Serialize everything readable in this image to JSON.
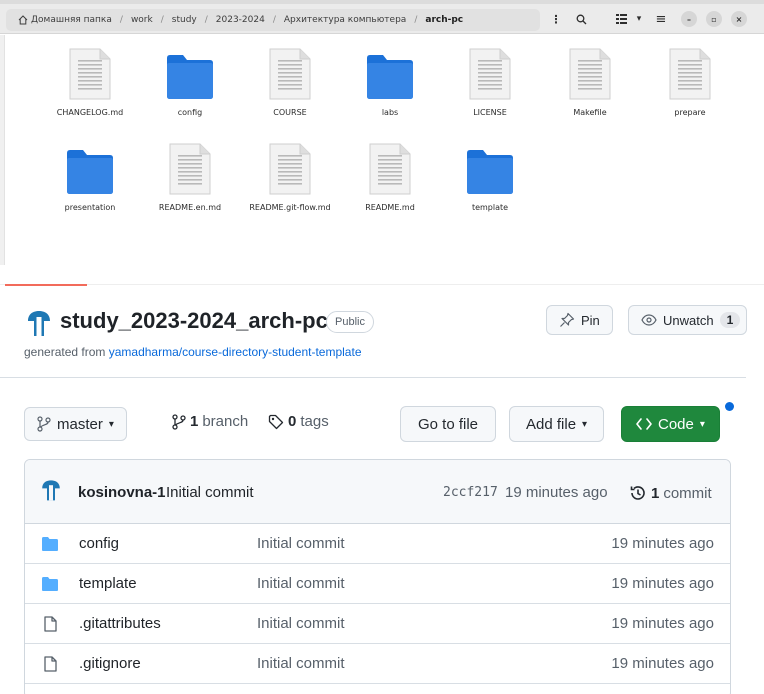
{
  "file_manager": {
    "breadcrumb": [
      "Домашняя папка",
      "work",
      "study",
      "2023-2024",
      "Архитектура компьютера",
      "arch-pc"
    ],
    "toolbar": {
      "menu_glyph": "⋮",
      "search_glyph": "🔍",
      "view_glyph": "⊞",
      "dropdown_glyph": "▾",
      "hamburger_glyph": "≡",
      "minimize_glyph": "–",
      "maximize_glyph": "▫",
      "close_glyph": "×"
    },
    "items": [
      {
        "name": "CHANGELOG.md",
        "kind": "document"
      },
      {
        "name": "config",
        "kind": "folder"
      },
      {
        "name": "COURSE",
        "kind": "document"
      },
      {
        "name": "labs",
        "kind": "folder"
      },
      {
        "name": "LICENSE",
        "kind": "document"
      },
      {
        "name": "Makefile",
        "kind": "document"
      },
      {
        "name": "prepare",
        "kind": "document"
      },
      {
        "name": "presentation",
        "kind": "folder"
      },
      {
        "name": "README.en.md",
        "kind": "document"
      },
      {
        "name": "README.git-flow.md",
        "kind": "document"
      },
      {
        "name": "README.md",
        "kind": "document"
      },
      {
        "name": "template",
        "kind": "folder"
      }
    ],
    "colors": {
      "folder": "#3584e4",
      "folder_dark": "#1c71d8",
      "document": "#f2f2f2"
    }
  },
  "github": {
    "repo_name": "study_2023-2024_arch-pc",
    "visibility": "Public",
    "generated_from_prefix": "generated from ",
    "generated_from_link": "yamadharma/course-directory-student-template",
    "pin_label": "Pin",
    "unwatch_label": "Unwatch",
    "watch_count": "1",
    "branch_name": "master",
    "branch_count": "1",
    "branch_label": "branch",
    "tag_count": "0",
    "tag_label": "tags",
    "goto_file_label": "Go to file",
    "add_file_label": "Add file",
    "code_label": "Code",
    "commit": {
      "author": "kosinovna-1",
      "message": "Initial commit",
      "sha": "2ccf217",
      "time": "19 minutes ago",
      "count": "1",
      "count_label": "commit"
    },
    "files": [
      {
        "name": "config",
        "kind": "folder",
        "message": "Initial commit",
        "time": "19 minutes ago"
      },
      {
        "name": "template",
        "kind": "folder",
        "message": "Initial commit",
        "time": "19 minutes ago"
      },
      {
        "name": ".gitattributes",
        "kind": "file",
        "message": "Initial commit",
        "time": "19 minutes ago"
      },
      {
        "name": ".gitignore",
        "kind": "file",
        "message": "Initial commit",
        "time": "19 minutes ago"
      }
    ],
    "colors": {
      "accent": "#0969da",
      "code_button": "#1f883d",
      "folder_icon": "#54aeff",
      "avatar": "#1f78b4"
    }
  }
}
